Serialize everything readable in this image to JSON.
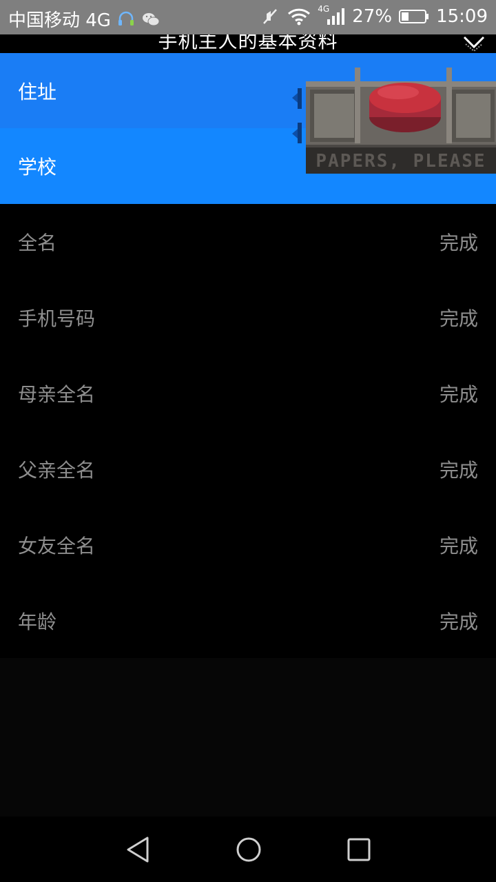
{
  "status_bar": {
    "carrier": "中国移动 4G",
    "network_small": "4G",
    "battery": "27%",
    "time": "15:09"
  },
  "header": {
    "title": "手机主人的基本资料",
    "close_icon": "close-chevron-icon"
  },
  "logo": {
    "text": "PAPERS, PLEASE"
  },
  "rows": [
    {
      "label": "住址",
      "status": ""
    },
    {
      "label": "学校",
      "status": ""
    },
    {
      "label": "全名",
      "status": "完成"
    },
    {
      "label": "手机号码",
      "status": "完成"
    },
    {
      "label": "母亲全名",
      "status": "完成"
    },
    {
      "label": "父亲全名",
      "status": "完成"
    },
    {
      "label": "女友全名",
      "status": "完成"
    },
    {
      "label": "年龄",
      "status": "完成"
    }
  ],
  "colors": {
    "selected_row_1": "#1a7df5",
    "selected_row_2": "#1387ff",
    "text_dim": "#8e8e8e"
  }
}
